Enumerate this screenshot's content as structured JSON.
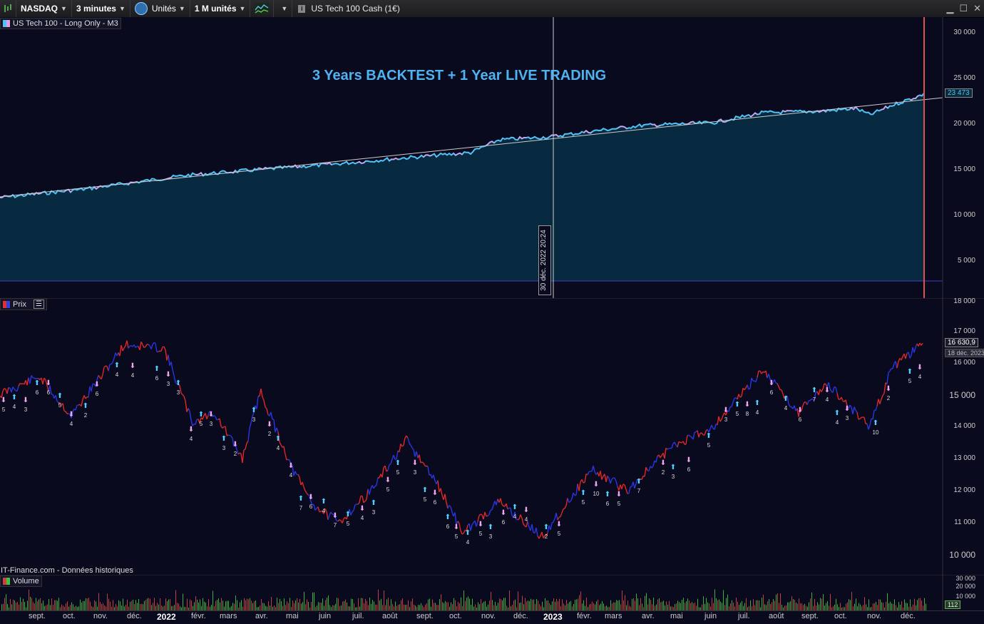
{
  "toolbar": {
    "exchange": "NASDAQ",
    "interval": "3 minutes",
    "units": "Unités",
    "size": "1 M unités",
    "instrument_title": "US Tech 100 Cash (1€)"
  },
  "top_panel": {
    "label": "US Tech 100 - Long Only - M3",
    "annotation": "3 Years BACKTEST + 1 Year LIVE TRADING",
    "cursor_date": "30 déc. 2022 20:24",
    "y_ticks": [
      "30 000",
      "25 000",
      "20 000",
      "15 000",
      "10 000",
      "5 000"
    ],
    "current_value": "23 473",
    "colors": {
      "equity_fill": "#082a40",
      "equity_line": "#4fc3f7",
      "equity_alt": "#e59be8",
      "trend": "#cccccc",
      "live_marker": "#e05050"
    }
  },
  "middle_panel": {
    "label": "Prix",
    "y_ticks": [
      "18 000",
      "17 000",
      "16 000",
      "15 000",
      "14 000",
      "13 000",
      "12 000",
      "11 000",
      "10 000"
    ],
    "current_price": "16 630,9",
    "current_date": "18 déc. 2023",
    "source": "IT-Finance.com - Données historiques",
    "signal_numbers": [
      "5",
      "4",
      "3",
      "6",
      "6",
      "5",
      "4",
      "2",
      "6",
      "4",
      "4",
      "6",
      "3",
      "3",
      "4",
      "5",
      "3",
      "3",
      "2",
      "3",
      "2",
      "4",
      "4",
      "7",
      "6",
      "4",
      "7",
      "5",
      "4",
      "3",
      "5",
      "5",
      "3",
      "5",
      "6",
      "6",
      "5",
      "4",
      "5",
      "3",
      "6",
      "4",
      "4",
      "2",
      "5",
      "5",
      "10",
      "6",
      "5",
      "7",
      "2",
      "3",
      "6",
      "5",
      "3",
      "5",
      "8",
      "4",
      "6",
      "4",
      "6",
      "7",
      "4",
      "4",
      "3",
      "10",
      "2"
    ]
  },
  "volume_panel": {
    "label": "Volume",
    "y_ticks": [
      "30 000",
      "20 000",
      "10 000"
    ],
    "current_value": "112"
  },
  "x_axis": {
    "months": [
      "sept.",
      "oct.",
      "nov.",
      "déc.",
      "2022",
      "févr.",
      "mars",
      "avr.",
      "mai",
      "juin",
      "juil.",
      "août",
      "sept.",
      "oct.",
      "nov.",
      "déc.",
      "2023",
      "févr.",
      "mars",
      "avr.",
      "mai",
      "juin",
      "juil.",
      "août",
      "sept.",
      "oct.",
      "nov.",
      "déc."
    ]
  }
}
